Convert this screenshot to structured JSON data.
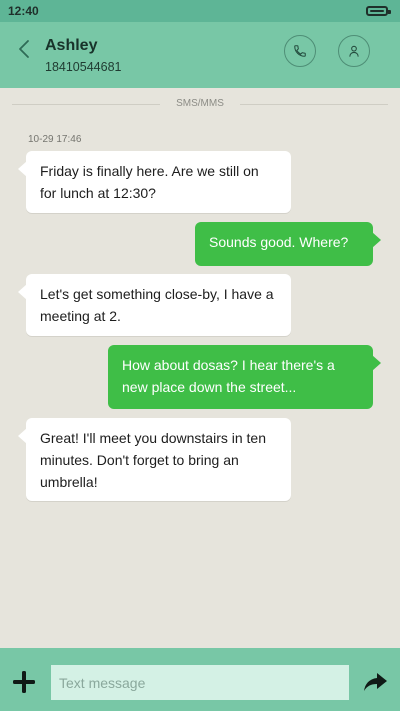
{
  "status_bar": {
    "time": "12:40"
  },
  "header": {
    "contact_name": "Ashley",
    "contact_number": "18410544681",
    "icons": {
      "back": "back-arrow-icon",
      "call": "phone-icon",
      "profile": "person-icon"
    }
  },
  "conversation": {
    "channel_label": "SMS/MMS",
    "timestamp": "10-29 17:46",
    "messages": [
      {
        "direction": "incoming",
        "text": "Friday is finally here. Are we still on for lunch at 12:30?"
      },
      {
        "direction": "outgoing",
        "text": "Sounds good. Where?"
      },
      {
        "direction": "incoming",
        "text": "Let's get something close-by, I have a meeting at 2."
      },
      {
        "direction": "outgoing",
        "text": "How about dosas? I hear there's a new place down the street..."
      },
      {
        "direction": "incoming",
        "text": "Great! I'll meet you downstairs in ten minutes. Don't forget to bring an umbrella!"
      }
    ]
  },
  "composer": {
    "placeholder": "Text message",
    "value": "",
    "icons": {
      "add": "plus-icon",
      "send": "send-arrow-icon"
    }
  },
  "colors": {
    "header_bg": "#78c7a6",
    "status_bg": "#5eb596",
    "conversation_bg": "#e6e4dc",
    "incoming_bubble": "#ffffff",
    "outgoing_bubble": "#3fbe47",
    "input_bg": "#d4f1e5"
  }
}
